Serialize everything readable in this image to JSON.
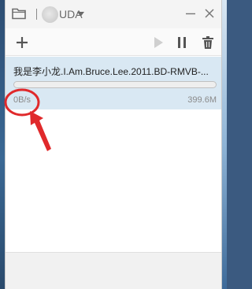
{
  "window": {
    "title": "UDA",
    "icons": {
      "folder": "folder-icon",
      "avatar": "avatar",
      "dropdown": "caret-down-icon",
      "minimize": "minimize-icon",
      "close": "close-icon"
    }
  },
  "toolbar": {
    "add": "plus-icon",
    "start": "play-icon",
    "pause": "pause-icon",
    "delete": "trash-icon"
  },
  "tasks": [
    {
      "name": "我是李小龙.I.Am.Bruce.Lee.2011.BD-RMVB-...",
      "speed": "0B/s",
      "size": "399.6M",
      "progress": 0
    }
  ],
  "colors": {
    "selected_row": "#d9e8f3",
    "annotation": "#e0292b",
    "toolbar_icon": "#555555",
    "disabled_icon": "#cfcfcf"
  }
}
